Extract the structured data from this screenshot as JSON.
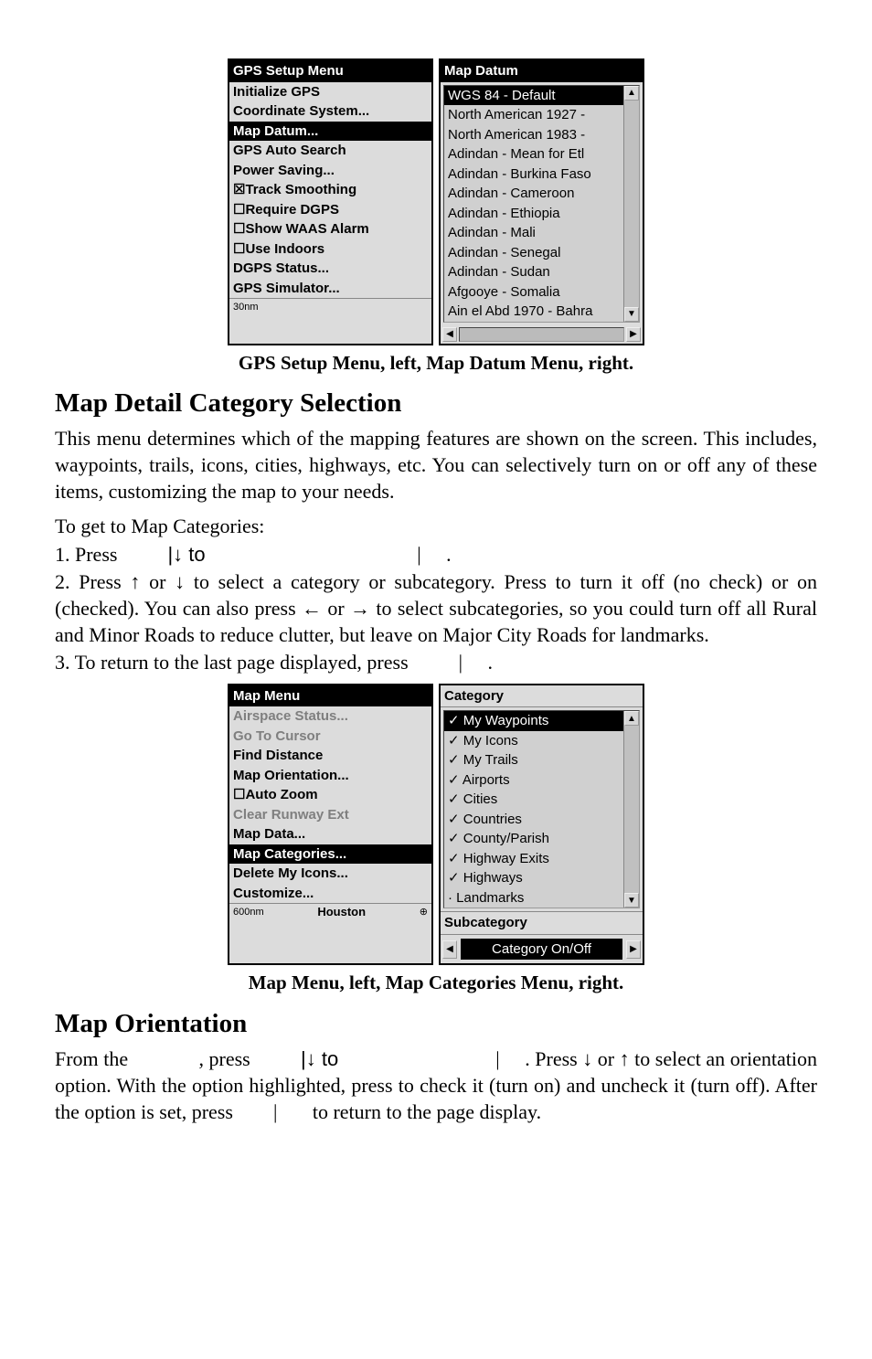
{
  "figure1": {
    "left": {
      "title": "GPS Setup Menu",
      "items": [
        {
          "t": "Initialize GPS",
          "b": true
        },
        {
          "t": "Coordinate System...",
          "b": true
        },
        {
          "t": "Map Datum...",
          "b": true,
          "sel": true
        },
        {
          "t": "GPS Auto Search",
          "b": true
        },
        {
          "t": "Power Saving...",
          "b": true
        },
        {
          "t": "☒Track Smoothing",
          "b": true
        },
        {
          "t": "☐Require DGPS",
          "b": true
        },
        {
          "t": "☐Show WAAS Alarm",
          "b": true
        },
        {
          "t": "☐Use Indoors",
          "b": true
        },
        {
          "t": "DGPS Status...",
          "b": true
        },
        {
          "t": "GPS Simulator...",
          "b": true
        }
      ],
      "footer": "30nm"
    },
    "right": {
      "title": "Map Datum",
      "items": [
        {
          "t": "WGS 84 - Default",
          "sel": true
        },
        {
          "t": "North American 1927 -"
        },
        {
          "t": "North American 1983 -"
        },
        {
          "t": "Adindan - Mean for Etl"
        },
        {
          "t": "Adindan - Burkina Faso"
        },
        {
          "t": "Adindan - Cameroon"
        },
        {
          "t": "Adindan - Ethiopia"
        },
        {
          "t": "Adindan - Mali"
        },
        {
          "t": "Adindan - Senegal"
        },
        {
          "t": "Adindan - Sudan"
        },
        {
          "t": "Afgooye - Somalia"
        },
        {
          "t": "Ain el Abd 1970 - Bahra"
        }
      ]
    },
    "caption": "GPS Setup Menu, left, Map Datum Menu, right."
  },
  "section1": {
    "heading": "Map Detail Category Selection",
    "p1": "This menu determines which of the mapping features are shown on the screen. This includes, waypoints, trails, icons, cities, highways, etc. You can selectively turn on or off any of these items, customizing the map to your needs.",
    "lead": "To get to Map Categories:",
    "step1a": "1. Press ",
    "step1b": "|↓ to ",
    "step1c": "|",
    "step1d": ".",
    "step2": "2. Press ↑ or ↓ to select a category or subcategory. Press         to turn it off (no check) or on (checked). You can also press ← or → to select subcategories, so you could turn off all Rural and Minor Roads to reduce clutter, but leave on Major City Roads for landmarks.",
    "step3a": "3. To return to the last page displayed, press ",
    "step3b": "|",
    "step3c": "."
  },
  "figure2": {
    "left": {
      "title": "Map Menu",
      "items": [
        {
          "t": "Airspace Status...",
          "dim": true,
          "b": true
        },
        {
          "t": "Go To Cursor",
          "dim": true,
          "b": true
        },
        {
          "t": "Find Distance",
          "b": true
        },
        {
          "t": "Map Orientation...",
          "b": true
        },
        {
          "t": "☐Auto Zoom",
          "b": true
        },
        {
          "t": "Clear Runway Ext",
          "dim": true,
          "b": true
        },
        {
          "t": "Map Data...",
          "b": true
        },
        {
          "t": "Map Categories...",
          "b": true,
          "sel": true
        },
        {
          "t": "Delete My Icons...",
          "b": true
        },
        {
          "t": "Customize...",
          "b": true
        }
      ],
      "footer": "600nm",
      "footer2": "Houston"
    },
    "right": {
      "title": "Category",
      "items": [
        {
          "t": "✓ My Waypoints",
          "sel": true
        },
        {
          "t": "✓ My Icons"
        },
        {
          "t": "✓ My Trails"
        },
        {
          "t": "✓ Airports"
        },
        {
          "t": "✓ Cities"
        },
        {
          "t": "✓ Countries"
        },
        {
          "t": "✓ County/Parish"
        },
        {
          "t": "✓ Highway Exits"
        },
        {
          "t": "✓ Highways"
        },
        {
          "t": "· Landmarks"
        }
      ],
      "subcat_label": "Subcategory",
      "subcat_btn": "Category On/Off"
    },
    "caption": "Map Menu, left, Map Categories Menu, right."
  },
  "section2": {
    "heading": "Map Orientation",
    "p_a": "From the ",
    "p_b": ", press ",
    "p_c": "|↓ to ",
    "p_d": "|",
    "p_e": ". Press ↓ or ↑ to select an orientation option. With the option highlighted, press          to check it (turn on) and uncheck it (turn off). After the option is set, press ",
    "p_f": "|",
    "p_g": " to return to the page display."
  }
}
